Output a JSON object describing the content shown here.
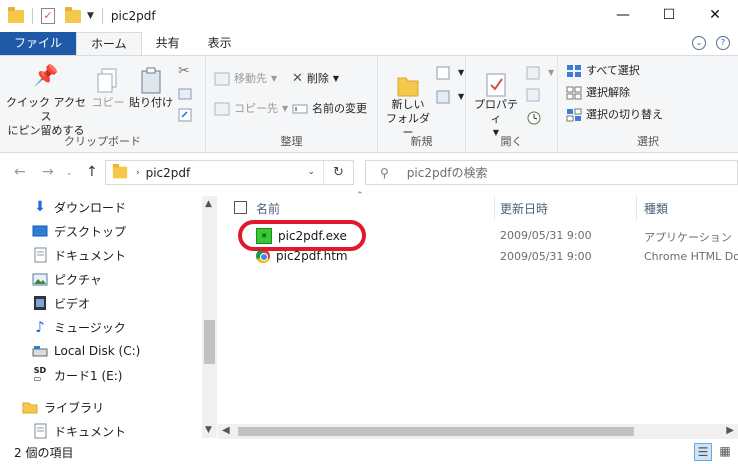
{
  "window": {
    "title": "pic2pdf",
    "minimize": "—",
    "maximize": "☐",
    "close": "✕"
  },
  "ribbon_tabs": [
    {
      "label": "ファイル"
    },
    {
      "label": "ホーム"
    },
    {
      "label": "共有"
    },
    {
      "label": "表示"
    }
  ],
  "ribbon": {
    "clipboard": {
      "group_label": "クリップボード",
      "pin_line1": "クイック アクセス",
      "pin_line2": "にピン留めする",
      "copy": "コピー",
      "paste": "貼り付け"
    },
    "organize": {
      "group_label": "整理",
      "move_to": "移動先",
      "copy_to": "コピー先",
      "delete": "削除",
      "rename": "名前の変更"
    },
    "new": {
      "group_label": "新規",
      "new_folder_line1": "新しい",
      "new_folder_line2": "フォルダー"
    },
    "open": {
      "group_label": "開く",
      "properties": "プロパティ"
    },
    "select": {
      "group_label": "選択",
      "select_all": "すべて選択",
      "select_none": "選択解除",
      "invert": "選択の切り替え"
    }
  },
  "address": {
    "crumb": "pic2pdf",
    "search_placeholder": "pic2pdfの検索"
  },
  "nav_items": [
    {
      "label": "ダウンロード",
      "icon": "download-icon"
    },
    {
      "label": "デスクトップ",
      "icon": "desktop-icon"
    },
    {
      "label": "ドキュメント",
      "icon": "documents-icon"
    },
    {
      "label": "ピクチャ",
      "icon": "pictures-icon"
    },
    {
      "label": "ビデオ",
      "icon": "videos-icon"
    },
    {
      "label": "ミュージック",
      "icon": "music-icon"
    },
    {
      "label": "Local Disk (C:)",
      "icon": "drive-icon"
    },
    {
      "label": "カード1 (E:)",
      "icon": "sd-card-icon"
    },
    {
      "label": "ライブラリ",
      "icon": "library-icon"
    },
    {
      "label": "ドキュメント",
      "icon": "documents-icon"
    }
  ],
  "columns": {
    "name": "名前",
    "date": "更新日時",
    "type": "種類"
  },
  "files": [
    {
      "name": "pic2pdf.exe",
      "date": "2009/05/31 9:00",
      "type": "アプリケーション",
      "icon": "exe-icon"
    },
    {
      "name": "pic2pdf.htm",
      "date": "2009/05/31 9:00",
      "type": "Chrome HTML Do",
      "icon": "chrome-icon"
    }
  ],
  "status": {
    "count": "2 個の項目"
  },
  "colors": {
    "file_tab": "#1e5aa8",
    "highlight": "#e0192e"
  }
}
